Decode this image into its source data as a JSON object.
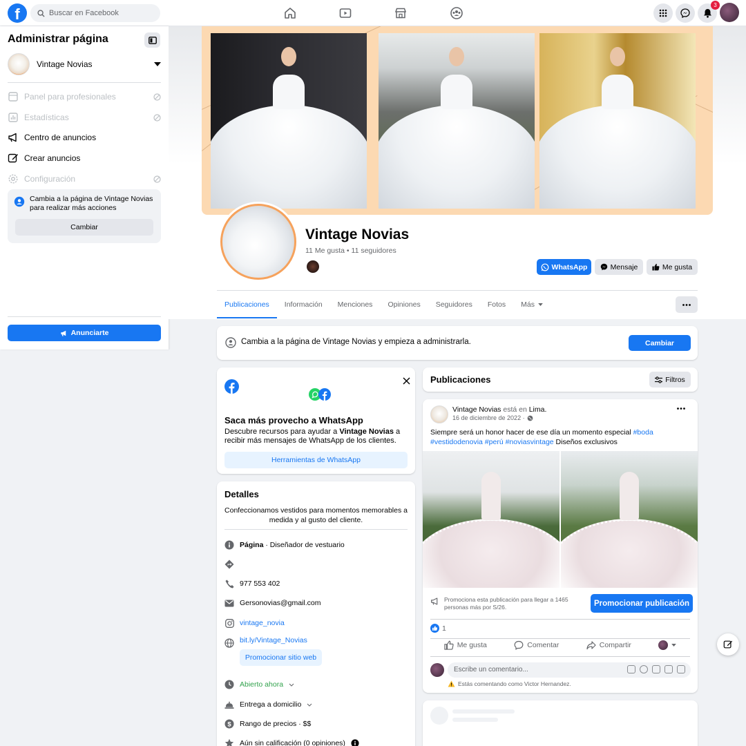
{
  "topbar": {
    "logo": "f",
    "search_placeholder": "Buscar en Facebook",
    "notifications_count": "3",
    "nav_icons": [
      "home-icon",
      "watch-icon",
      "marketplace-icon",
      "groups-icon"
    ]
  },
  "left_panel": {
    "title": "Administrar página",
    "page_name": "Vintage Novias",
    "items": [
      {
        "label": "Panel para profesionales",
        "enabled": false
      },
      {
        "label": "Estadísticas",
        "enabled": false
      },
      {
        "label": "Centro de anuncios",
        "enabled": true
      },
      {
        "label": "Crear anuncios",
        "enabled": true
      },
      {
        "label": "Configuración",
        "enabled": false
      }
    ],
    "switch_card": {
      "message": "Cambia a la página de Vintage Novias para realizar más acciones",
      "button": "Cambiar"
    },
    "advertise_button": "Anunciarte"
  },
  "page": {
    "name": "Vintage Novias",
    "stats": "11 Me gusta • 11 seguidores",
    "buttons": {
      "whatsapp": "WhatsApp",
      "message": "Mensaje",
      "like": "Me gusta"
    },
    "tabs": [
      "Publicaciones",
      "Información",
      "Menciones",
      "Opiniones",
      "Seguidores",
      "Fotos",
      "Más"
    ],
    "active_tab": "Publicaciones"
  },
  "switch_banner": {
    "text": "Cambia a la página de Vintage Novias y empieza a administrarla.",
    "button": "Cambiar"
  },
  "whatsapp_card": {
    "title": "Saca más provecho a WhatsApp",
    "desc_pre": "Descubre recursos para ayudar a ",
    "desc_bold": "Vintage Novias",
    "desc_post": " a recibir más mensajes de WhatsApp de los clientes.",
    "button": "Herramientas de WhatsApp"
  },
  "details": {
    "title": "Detalles",
    "bio": "Confeccionamos vestidos para momentos memorables a medida y al gusto del cliente.",
    "page_label": "Página",
    "category": " · Diseñador de vestuario",
    "phone": "977 553 402",
    "email": "Gersonovias@gmail.com",
    "instagram": "vintage_novia",
    "website": "bit.ly/Vintage_Novias",
    "promote_site": "Promocionar sitio web",
    "hours": "Abierto ahora",
    "delivery": "Entrega a domicilio",
    "price": "Rango de precios · $$",
    "rating": "Aún sin calificación (0 opiniones)"
  },
  "publications": {
    "title": "Publicaciones",
    "filters": "Filtros",
    "post": {
      "author": "Vintage Novias",
      "location_pre": " está en ",
      "location": "Lima",
      "date": "16 de diciembre de 2022 ·",
      "text_plain": "Siempre será un honor hacer de ese día un momento especial ",
      "tag1": "#boda",
      "tags2": "#vestidodenovia #perú #noviasvintage",
      "text_end": " Diseños exclusivos",
      "promo_text": "Promociona esta publicación para llegar a 1465 personas más por S/26.",
      "promo_button": "Promocionar publicación",
      "likes_count": "1",
      "actions": [
        "Me gusta",
        "Comentar",
        "Compartir"
      ],
      "comment_placeholder": "Escribe un comentario...",
      "commenting_as": "Estás comentando como Victor Hernandez."
    }
  },
  "colors": {
    "brand": "#1877f2",
    "cover": "#fcd9b2",
    "profile_ring": "#f6a25c",
    "badge": "#e41e3f"
  }
}
